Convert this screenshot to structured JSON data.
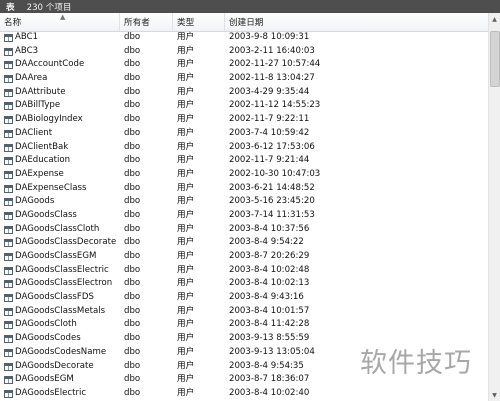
{
  "titlebar": {
    "label": "表",
    "count": "230 个项目"
  },
  "columns": {
    "name": "名称",
    "owner": "所有者",
    "type": "类型",
    "date": "创建日期"
  },
  "rows": [
    {
      "name": "ABC1",
      "owner": "dbo",
      "type": "用户",
      "date": "2003-9-8 10:09:31"
    },
    {
      "name": "ABC3",
      "owner": "dbo",
      "type": "用户",
      "date": "2003-2-11 16:40:03"
    },
    {
      "name": "DAAccountCode",
      "owner": "dbo",
      "type": "用户",
      "date": "2002-11-27 10:57:44"
    },
    {
      "name": "DAArea",
      "owner": "dbo",
      "type": "用户",
      "date": "2002-11-8 13:04:27"
    },
    {
      "name": "DAAttribute",
      "owner": "dbo",
      "type": "用户",
      "date": "2003-4-29 9:35:44"
    },
    {
      "name": "DABillType",
      "owner": "dbo",
      "type": "用户",
      "date": "2002-11-12 14:55:23"
    },
    {
      "name": "DABiologyIndex",
      "owner": "dbo",
      "type": "用户",
      "date": "2002-11-7 9:22:11"
    },
    {
      "name": "DAClient",
      "owner": "dbo",
      "type": "用户",
      "date": "2003-7-4 10:59:42"
    },
    {
      "name": "DAClientBak",
      "owner": "dbo",
      "type": "用户",
      "date": "2003-6-12 17:53:06"
    },
    {
      "name": "DAEducation",
      "owner": "dbo",
      "type": "用户",
      "date": "2002-11-7 9:21:44"
    },
    {
      "name": "DAExpense",
      "owner": "dbo",
      "type": "用户",
      "date": "2002-10-30 10:47:03"
    },
    {
      "name": "DAExpenseClass",
      "owner": "dbo",
      "type": "用户",
      "date": "2003-6-21 14:48:52"
    },
    {
      "name": "DAGoods",
      "owner": "dbo",
      "type": "用户",
      "date": "2003-5-16 23:45:20"
    },
    {
      "name": "DAGoodsClass",
      "owner": "dbo",
      "type": "用户",
      "date": "2003-7-14 11:31:53"
    },
    {
      "name": "DAGoodsClassCloth",
      "owner": "dbo",
      "type": "用户",
      "date": "2003-8-4 10:37:56"
    },
    {
      "name": "DAGoodsClassDecorate",
      "owner": "dbo",
      "type": "用户",
      "date": "2003-8-4 9:54:22"
    },
    {
      "name": "DAGoodsClassEGM",
      "owner": "dbo",
      "type": "用户",
      "date": "2003-8-7 20:26:29"
    },
    {
      "name": "DAGoodsClassElectric",
      "owner": "dbo",
      "type": "用户",
      "date": "2003-8-4 10:02:48"
    },
    {
      "name": "DAGoodsClassElectron",
      "owner": "dbo",
      "type": "用户",
      "date": "2003-8-4 10:02:13"
    },
    {
      "name": "DAGoodsClassFDS",
      "owner": "dbo",
      "type": "用户",
      "date": "2003-8-4 9:43:16"
    },
    {
      "name": "DAGoodsClassMetals",
      "owner": "dbo",
      "type": "用户",
      "date": "2003-8-4 10:01:57"
    },
    {
      "name": "DAGoodsCloth",
      "owner": "dbo",
      "type": "用户",
      "date": "2003-8-4 11:42:28"
    },
    {
      "name": "DAGoodsCodes",
      "owner": "dbo",
      "type": "用户",
      "date": "2003-9-13 8:55:59"
    },
    {
      "name": "DAGoodsCodesName",
      "owner": "dbo",
      "type": "用户",
      "date": "2003-9-13 13:05:04"
    },
    {
      "name": "DAGoodsDecorate",
      "owner": "dbo",
      "type": "用户",
      "date": "2003-8-4 9:54:35"
    },
    {
      "name": "DAGoodsEGM",
      "owner": "dbo",
      "type": "用户",
      "date": "2003-8-7 18:36:07"
    },
    {
      "name": "DAGoodsElectric",
      "owner": "dbo",
      "type": "用户",
      "date": "2003-8-4 10:02:40"
    }
  ],
  "watermark": "软件技巧",
  "icons": {
    "table": "table-icon",
    "sort": "sort-ascending-icon",
    "scroll_up": "scroll-up-icon",
    "scroll_down": "scroll-down-icon"
  }
}
